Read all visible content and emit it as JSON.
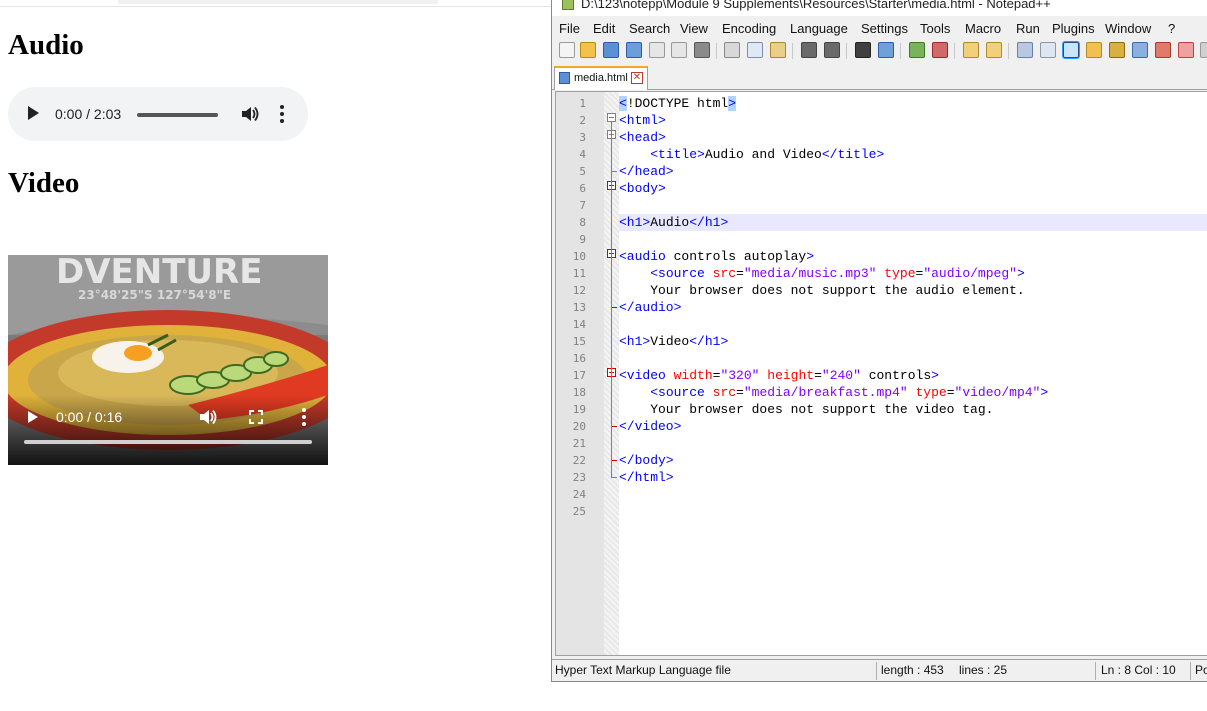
{
  "browser": {
    "audio_heading": "Audio",
    "video_heading": "Video",
    "audio_player": {
      "time": "0:00 / 2:03"
    },
    "video_player": {
      "time": "0:00 / 0:16",
      "poster_text": "DVENTURE",
      "coords_text": "23°48'25\"S   127°54'8\"E"
    }
  },
  "notepad": {
    "title": "D:\\123\\notepp\\Module 9 Supplements\\Resources\\Starter\\media.html - Notepad++",
    "menu": [
      "File",
      "Edit",
      "Search",
      "View",
      "Encoding",
      "Language",
      "Settings",
      "Tools",
      "Macro",
      "Run",
      "Plugins",
      "Window",
      "?"
    ],
    "tab_label": "media.html",
    "lines": [
      {
        "n": "1",
        "parts": [
          [
            "tag",
            "<"
          ],
          [
            "black",
            "!DOCTYPE html"
          ],
          [
            "tag",
            ">"
          ]
        ]
      },
      {
        "n": "2",
        "parts": [
          [
            "tag",
            "<html>"
          ]
        ]
      },
      {
        "n": "3",
        "parts": [
          [
            "tag",
            "<head>"
          ]
        ]
      },
      {
        "n": "4",
        "parts": [
          [
            "black",
            "    "
          ],
          [
            "tag",
            "<title>"
          ],
          [
            "black",
            "Audio and Video"
          ],
          [
            "tag",
            "</title>"
          ]
        ]
      },
      {
        "n": "5",
        "parts": [
          [
            "tag",
            "</head>"
          ]
        ]
      },
      {
        "n": "6",
        "parts": [
          [
            "tag",
            "<body>"
          ]
        ]
      },
      {
        "n": "7",
        "parts": []
      },
      {
        "n": "8",
        "parts": [
          [
            "tag",
            "<h1>"
          ],
          [
            "black",
            "Audio"
          ],
          [
            "tag",
            "</h1>"
          ]
        ]
      },
      {
        "n": "9",
        "parts": []
      },
      {
        "n": "10",
        "parts": [
          [
            "tag",
            "<audio "
          ],
          [
            "black",
            "controls autoplay"
          ],
          [
            "tag",
            ">"
          ]
        ]
      },
      {
        "n": "11",
        "parts": [
          [
            "black",
            "    "
          ],
          [
            "tag",
            "<source "
          ],
          [
            "attr",
            "src"
          ],
          [
            "black",
            "="
          ],
          [
            "val",
            "\"media/music.mp3\""
          ],
          [
            "black",
            " "
          ],
          [
            "attr",
            "type"
          ],
          [
            "black",
            "="
          ],
          [
            "val",
            "\"audio/mpeg\""
          ],
          [
            "tag",
            ">"
          ]
        ]
      },
      {
        "n": "12",
        "parts": [
          [
            "black",
            "    Your browser does not support the audio element."
          ]
        ]
      },
      {
        "n": "13",
        "parts": [
          [
            "tag",
            "</audio>"
          ]
        ]
      },
      {
        "n": "14",
        "parts": []
      },
      {
        "n": "15",
        "parts": [
          [
            "tag",
            "<h1>"
          ],
          [
            "black",
            "Video"
          ],
          [
            "tag",
            "</h1>"
          ]
        ]
      },
      {
        "n": "16",
        "parts": []
      },
      {
        "n": "17",
        "parts": [
          [
            "tag",
            "<video "
          ],
          [
            "attr",
            "width"
          ],
          [
            "black",
            "="
          ],
          [
            "val",
            "\"320\""
          ],
          [
            "black",
            " "
          ],
          [
            "attr",
            "height"
          ],
          [
            "black",
            "="
          ],
          [
            "val",
            "\"240\""
          ],
          [
            "black",
            " controls"
          ],
          [
            "tag",
            ">"
          ]
        ]
      },
      {
        "n": "18",
        "parts": [
          [
            "black",
            "    "
          ],
          [
            "tag",
            "<source "
          ],
          [
            "attr",
            "src"
          ],
          [
            "black",
            "="
          ],
          [
            "val",
            "\"media/breakfast.mp4\""
          ],
          [
            "black",
            " "
          ],
          [
            "attr",
            "type"
          ],
          [
            "black",
            "="
          ],
          [
            "val",
            "\"video/mp4\""
          ],
          [
            "tag",
            ">"
          ]
        ]
      },
      {
        "n": "19",
        "parts": [
          [
            "black",
            "    Your browser does not support the video tag."
          ]
        ]
      },
      {
        "n": "20",
        "parts": [
          [
            "tag",
            "</video>"
          ]
        ]
      },
      {
        "n": "21",
        "parts": []
      },
      {
        "n": "22",
        "parts": [
          [
            "tag",
            "</body>"
          ]
        ]
      },
      {
        "n": "23",
        "parts": [
          [
            "tag",
            "</html>"
          ]
        ]
      },
      {
        "n": "24",
        "parts": []
      },
      {
        "n": "25",
        "parts": []
      }
    ],
    "status": {
      "file_type": "Hyper Text Markup Language file",
      "length": "length : 453",
      "lines": "lines : 25",
      "position": "Ln : 8    Col : 10",
      "extra": "Po"
    },
    "colors": {
      "tag": "#0000ff",
      "attr": "#ff0000",
      "value": "#8000ff",
      "current_line": "#e8e8ff",
      "tab_accent": "#f3a530"
    }
  }
}
